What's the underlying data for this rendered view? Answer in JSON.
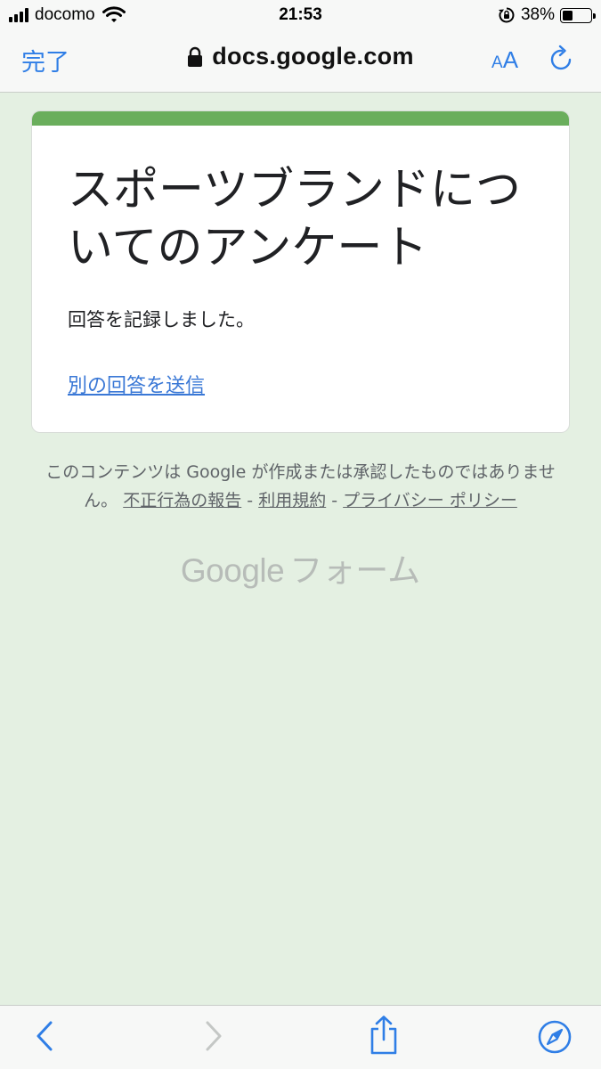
{
  "status_bar": {
    "carrier": "docomo",
    "time": "21:53",
    "battery_percent": "38%",
    "battery_level": 0.38,
    "icons": [
      "signal-bars-icon",
      "wifi-icon",
      "rotation-lock-icon",
      "battery-icon"
    ]
  },
  "browser": {
    "done_label": "完了",
    "url": "docs.google.com",
    "text_size_label": "AA",
    "icons": [
      "lock-icon",
      "reload-icon"
    ]
  },
  "form": {
    "accent_color": "#6aae5c",
    "title": "スポーツブランドについてのアンケート",
    "confirmation": "回答を記録しました。",
    "submit_another": "別の回答を送信"
  },
  "footer": {
    "disclaimer": "このコンテンツは Google が作成または承認したものではありません。",
    "report_abuse": "不正行為の報告",
    "separator": "-",
    "terms": "利用規約",
    "privacy": "プライバシー ポリシー",
    "logo_google": "Google",
    "logo_forms": "フォーム"
  },
  "toolbar": {
    "icons": [
      "back-chevron-icon",
      "forward-chevron-icon",
      "share-icon",
      "safari-compass-icon"
    ],
    "forward_enabled": false,
    "accent_color": "#2f7ee6"
  }
}
